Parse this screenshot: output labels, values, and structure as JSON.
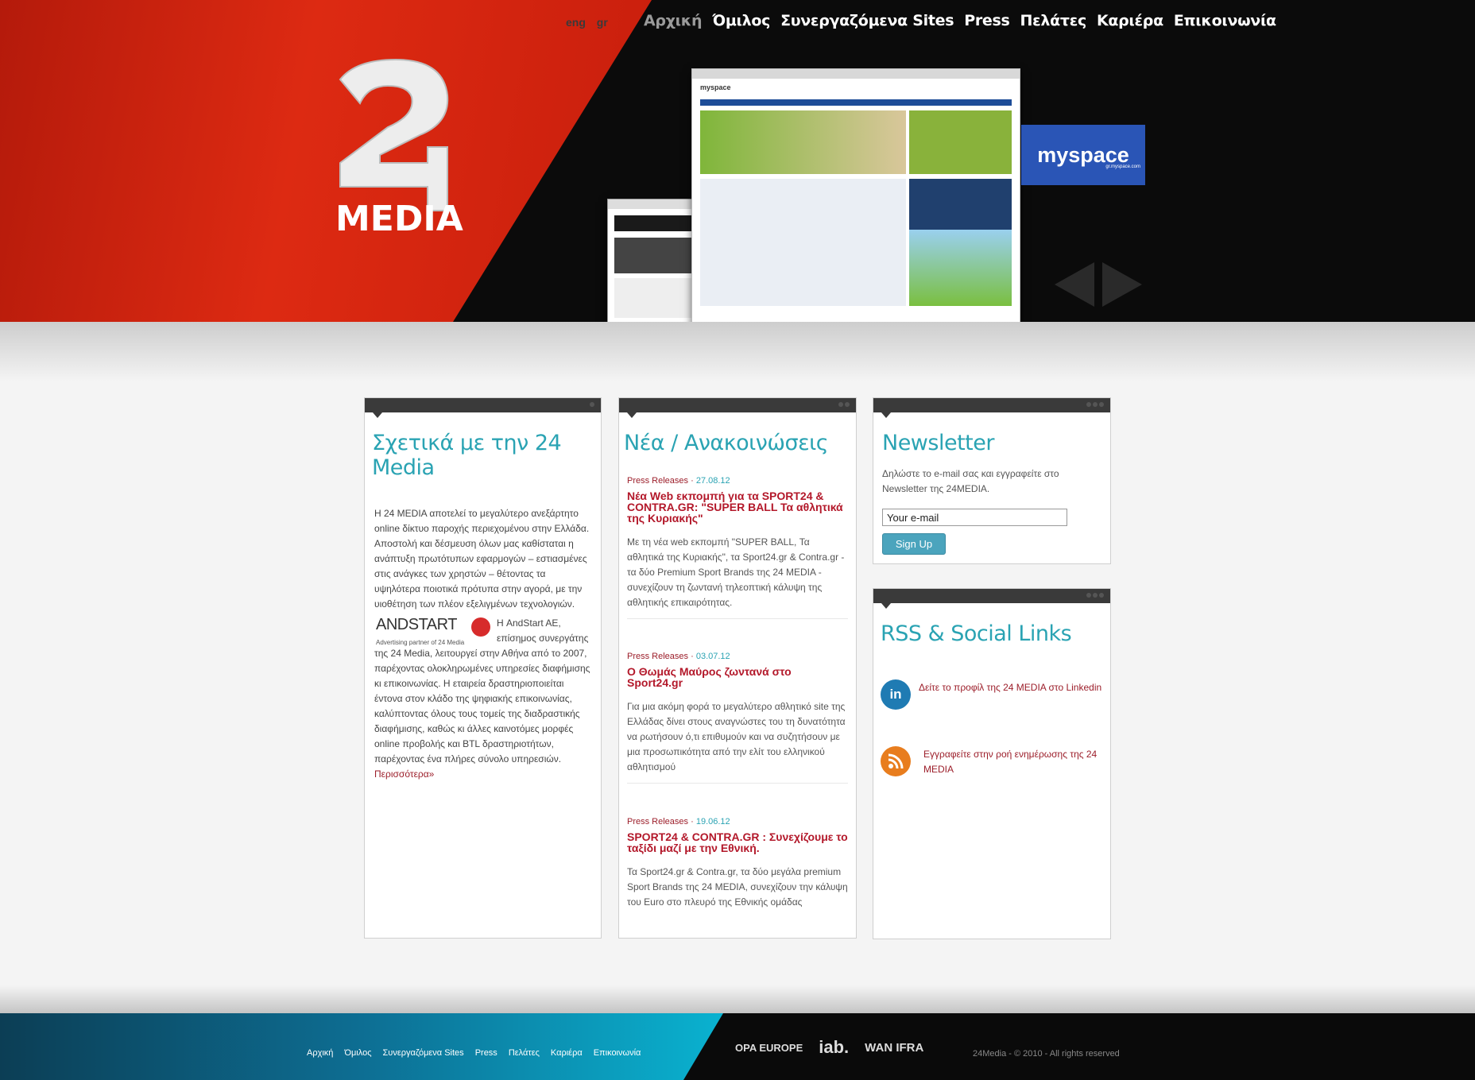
{
  "lang": {
    "en": "eng",
    "gr": "gr"
  },
  "nav": [
    "Αρχική",
    "Όμιλος",
    "Συνεργαζόμενα Sites",
    "Press",
    "Πελάτες",
    "Καριέρα",
    "Επικοινωνία"
  ],
  "logo": {
    "text": "MEDIA",
    "numeral": "24"
  },
  "slider": {
    "badge": "myspace",
    "badge_sub": "gr.myspace.com"
  },
  "about": {
    "title": "Σχετικά με την 24 Media",
    "paragraph": "Η 24 MEDIA αποτελεί το μεγαλύτερο ανεξάρτητο online δίκτυο παροχής περιεχομένου στην Ελλάδα. Αποστολή και δέσμευση όλων μας καθίσταται η ανάπτυξη πρωτότυπων εφαρμογών – εστιασμένες στις ανάγκες των χρηστών – θέτοντας τα υψηλότερα ποιοτικά πρότυπα στην αγορά, με την υιοθέτηση των πλέον εξελιγμένων τεχνολογιών.",
    "andstart_logo": "ANDSTART",
    "andstart_sub": "Advertising partner of 24 Media",
    "partner_text": "Η AndStart AE, επίσημος συνεργάτης της 24 Media, λειτουργεί στην Αθήνα από το 2007, παρέχοντας ολοκληρωμένες υπηρεσίες διαφήμισης κι επικοινωνίας. Η εταιρεία δραστηριοποιείται έντονα στον κλάδο της ψηφιακής επικοινωνίας, καλύπτοντας όλους τους τομείς της διαδραστικής διαφήμισης, καθώς κι άλλες καινοτόμες μορφές online προβολής και BTL δραστηριοτήτων, παρέχοντας ένα πλήρες σύνολο υπηρεσιών.",
    "more": "Περισσότερα»"
  },
  "news": {
    "title": "Νέα / Ανακοινώσεις",
    "items": [
      {
        "category": "Press Releases",
        "date": "27.08.12",
        "headline": "Νέα Web εκπομπή για τα SPORT24 & CONTRA.GR: \"SUPER BALL Τα αθλητικά της Κυριακής\"",
        "text": "Με τη νέα web εκπομπή \"SUPER BALL, Τα αθλητικά της Κυριακής\", τα Sport24.gr & Contra.gr - τα δύο Premium Sport Brands της 24 MEDIA - συνεχίζουν τη ζωντανή τηλεοπτική κάλυψη της αθλητικής επικαιρότητας."
      },
      {
        "category": "Press Releases",
        "date": "03.07.12",
        "headline": "Ο Θωμάς Μαύρος ζωντανά στο Sport24.gr",
        "text": "Για μια ακόμη φορά το μεγαλύτερο αθλητικό site της Ελλάδας δίνει στους αναγνώστες του τη δυνατότητα να ρωτήσουν ό,τι επιθυμούν και να συζητήσουν με μια προσωπικότητα από την ελίτ του ελληνικού αθλητισμού"
      },
      {
        "category": "Press Releases",
        "date": "19.06.12",
        "headline": "SPORT24 & CONTRA.GR : Συνεχίζουμε το ταξίδι μαζί με την Εθνική.",
        "text": "Τα Sport24.gr & Contra.gr, τα δύο μεγάλα premium Sport Brands της 24 MEDIA, συνεχίζουν την κάλυψη του Euro στο πλευρό της Εθνικής ομάδας"
      }
    ]
  },
  "newsletter": {
    "title": "Newsletter",
    "text": "Δηλώστε το e-mail σας και εγγραφείτε στο Newsletter της 24MEDIA.",
    "email_value": "Your e-mail",
    "button": "Sign Up"
  },
  "social": {
    "title": "RSS & Social Links",
    "linkedin_icon": "in",
    "linkedin": "Δείτε το προφίλ της 24 MEDIA στο Linkedin",
    "rss": "Εγγραφείτε στην ροή ενημέρωσης της 24 MEDIA"
  },
  "footer": {
    "nav": [
      "Αρχική",
      "Όμιλος",
      "Συνεργαζόμενα Sites",
      "Press",
      "Πελάτες",
      "Καριέρα",
      "Επικοινωνία"
    ],
    "logos": [
      "OPA EUROPE",
      "iab.",
      "WAN IFRA"
    ],
    "copyright": "24Media - © 2010 - All rights reserved"
  },
  "colors": {
    "accent": "#2aa3b3",
    "link": "#9c1e2a",
    "red": "#dd2a12"
  }
}
